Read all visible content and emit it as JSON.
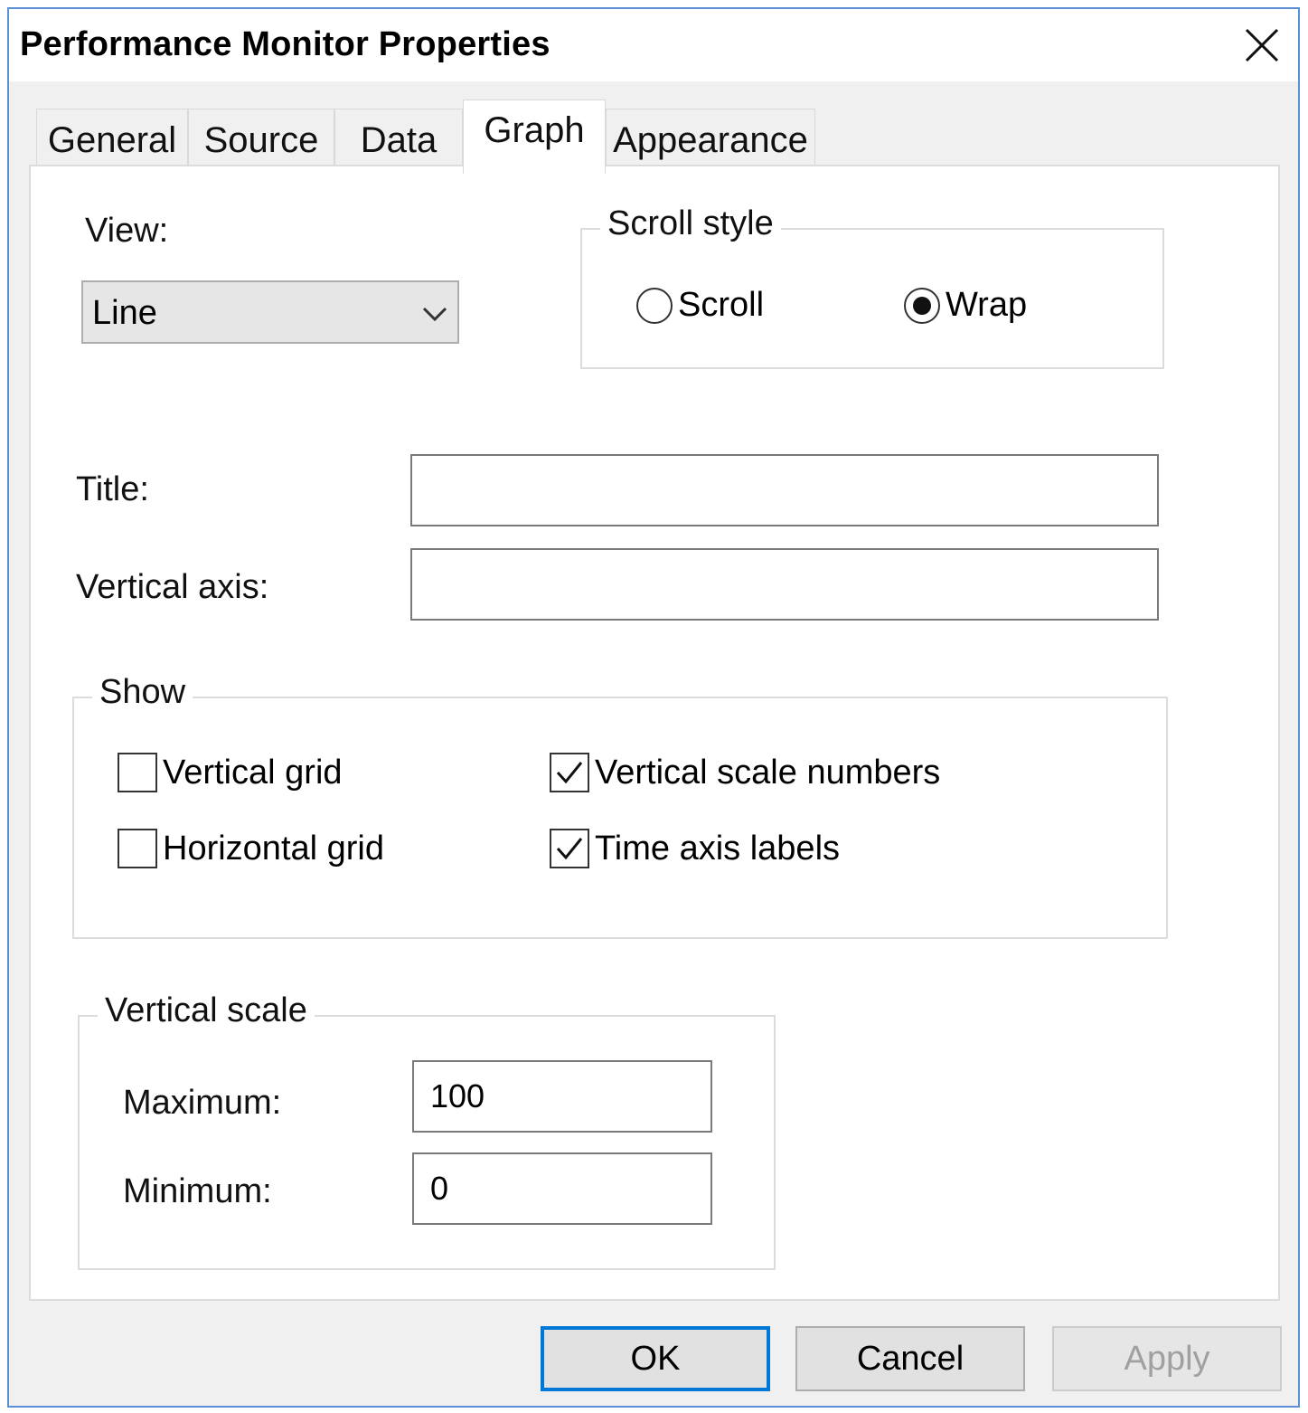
{
  "window": {
    "title": "Performance Monitor Properties"
  },
  "tabs": [
    {
      "label": "General"
    },
    {
      "label": "Source"
    },
    {
      "label": "Data"
    },
    {
      "label": "Graph",
      "active": true
    },
    {
      "label": "Appearance"
    }
  ],
  "graph": {
    "view_label": "View:",
    "view_value": "Line",
    "scroll_style": {
      "title": "Scroll style",
      "options": [
        {
          "label": "Scroll",
          "checked": false
        },
        {
          "label": "Wrap",
          "checked": true
        }
      ]
    },
    "title_label": "Title:",
    "title_value": "",
    "vertical_axis_label": "Vertical axis:",
    "vertical_axis_value": "",
    "show": {
      "title": "Show",
      "vertical_grid": {
        "label": "Vertical grid",
        "checked": false
      },
      "horizontal_grid": {
        "label": "Horizontal grid",
        "checked": false
      },
      "vertical_scale_numbers": {
        "label": "Vertical scale numbers",
        "checked": true
      },
      "time_axis_labels": {
        "label": "Time axis labels",
        "checked": true
      }
    },
    "vertical_scale": {
      "title": "Vertical scale",
      "maximum_label": "Maximum:",
      "maximum_value": "100",
      "minimum_label": "Minimum:",
      "minimum_value": "0"
    }
  },
  "buttons": {
    "ok": "OK",
    "cancel": "Cancel",
    "apply": "Apply"
  },
  "colors": {
    "accent": "#0078d7",
    "window_border": "#5b8fd6"
  },
  "icons": {
    "close": "close-icon",
    "combo": "chevron-down-icon"
  }
}
